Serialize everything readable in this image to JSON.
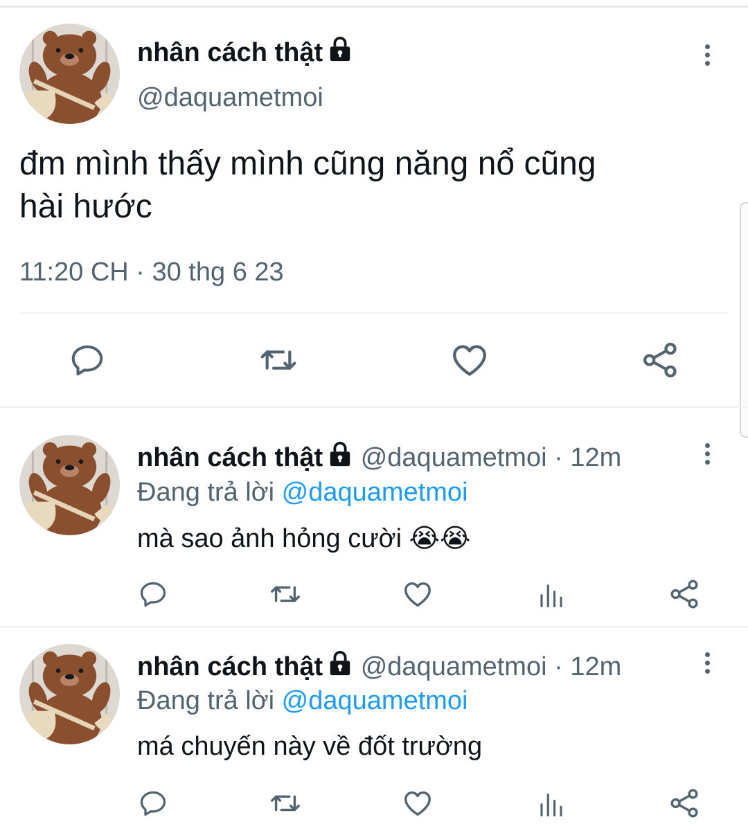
{
  "main_tweet": {
    "display_name": "nhân cách thật",
    "handle": "@daquametmoi",
    "text_line1": "đm mình thấy mình cũng năng nổ cũng",
    "text_line2": "hài hước",
    "timestamp": "11:20 CH · 30 thg 6 23",
    "actions": [
      "reply-icon",
      "retweet-icon",
      "like-icon",
      "share-icon"
    ]
  },
  "replies": [
    {
      "display_name": "nhân cách thật",
      "handle": "@daquametmoi",
      "time": "· 12m",
      "replying_prefix": "Đang trả lời",
      "replying_to": "@daquametmoi",
      "text": "mà sao ảnh hỏng cười",
      "emoji": "😭😭"
    },
    {
      "display_name": "nhân cách thật",
      "handle": "@daquametmoi",
      "time": "· 12m",
      "replying_prefix": "Đang trả lời",
      "replying_to": "@daquametmoi",
      "text": "má chuyến này về đốt trường"
    }
  ],
  "colors": {
    "text": "#0f1419",
    "secondary": "#536471",
    "link": "#1d9bf0",
    "avatar_bear": "#8a4f2e"
  }
}
